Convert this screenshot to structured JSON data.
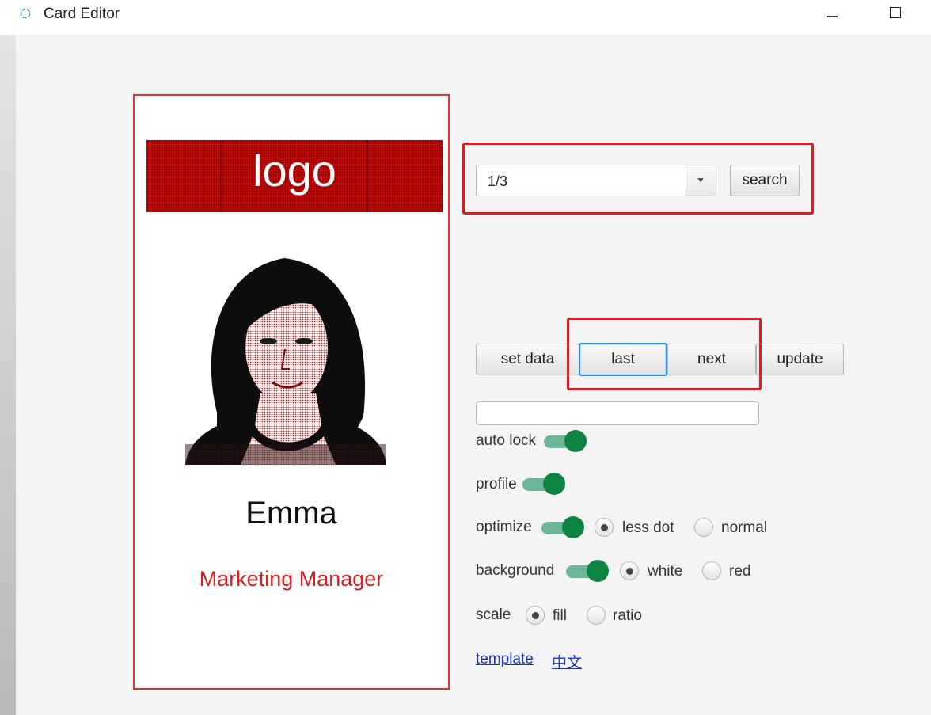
{
  "window": {
    "title": "Card Editor"
  },
  "card": {
    "logo_text": "logo",
    "name": "Emma",
    "job_title": "Marketing Manager"
  },
  "controls": {
    "record_select": {
      "value": "1/3"
    },
    "search_label": "search",
    "set_data_label": "set data",
    "last_label": "last",
    "next_label": "next",
    "update_label": "update",
    "progress": 0,
    "auto_lock": {
      "label": "auto lock",
      "on": true
    },
    "profile": {
      "label": "profile",
      "on": true
    },
    "optimize": {
      "label": "optimize",
      "on": true,
      "options": [
        "less dot",
        "normal"
      ],
      "selected": "less dot"
    },
    "background": {
      "label": "background",
      "on": true,
      "options": [
        "white",
        "red"
      ],
      "selected": "white"
    },
    "scale": {
      "label": "scale",
      "options": [
        "fill",
        "ratio"
      ],
      "selected": "fill"
    },
    "links": {
      "template": "template",
      "chinese": "中文"
    }
  },
  "colors": {
    "accent_red": "#d31f1f",
    "toggle_green": "#0e8442",
    "focus_blue": "#2f8fe0"
  }
}
